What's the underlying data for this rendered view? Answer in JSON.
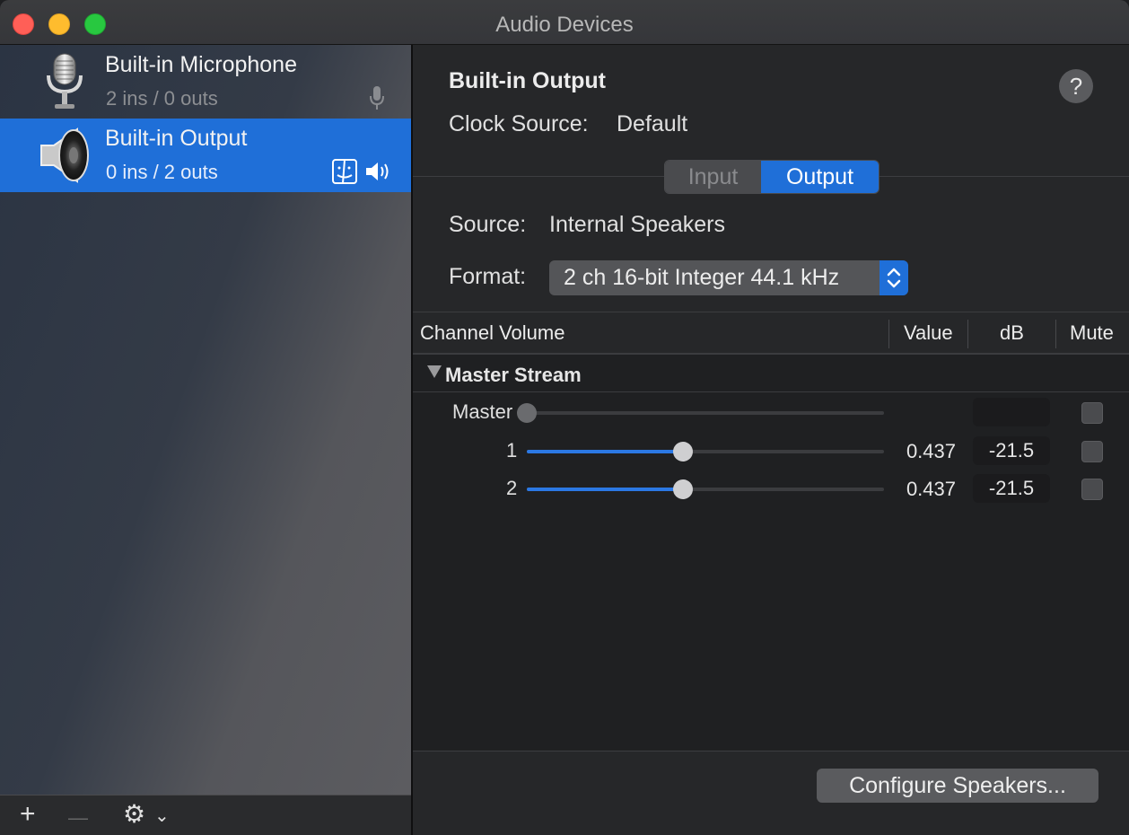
{
  "window": {
    "title": "Audio Devices"
  },
  "sidebar": {
    "devices": [
      {
        "name": "Built-in Microphone",
        "io": "2 ins / 0 outs",
        "icon": "microphone-icon",
        "selected": false
      },
      {
        "name": "Built-in Output",
        "io": "0 ins / 2 outs",
        "icon": "speaker-icon",
        "selected": true
      }
    ],
    "footer": {
      "add": "+",
      "remove": "—",
      "gear": "⚙",
      "chevron": "⌄"
    }
  },
  "detail": {
    "device_title": "Built-in Output",
    "help": "?",
    "clock_label": "Clock Source:",
    "clock_value": "Default",
    "tabs": [
      {
        "label": "Input",
        "active": false
      },
      {
        "label": "Output",
        "active": true
      }
    ],
    "source_label": "Source:",
    "source_value": "Internal Speakers",
    "format_label": "Format:",
    "format_value": "2 ch 16-bit Integer 44.1 kHz",
    "table": {
      "headers": {
        "channel": "Channel Volume",
        "value": "Value",
        "db": "dB",
        "mute": "Mute"
      },
      "group": "Master Stream",
      "rows": [
        {
          "label": "Master",
          "level": 0,
          "value": "",
          "db": "",
          "muted": false,
          "enabled": false
        },
        {
          "label": "1",
          "level": 0.437,
          "value": "0.437",
          "db": "-21.5",
          "muted": false,
          "enabled": true
        },
        {
          "label": "2",
          "level": 0.437,
          "value": "0.437",
          "db": "-21.5",
          "muted": false,
          "enabled": true
        }
      ]
    },
    "configure_button": "Configure Speakers..."
  },
  "colors": {
    "accent": "#1f6fd8",
    "slider_fill": "#2b78e4",
    "close": "#ff5f57",
    "minimize": "#febc2e",
    "zoom": "#28c840"
  }
}
